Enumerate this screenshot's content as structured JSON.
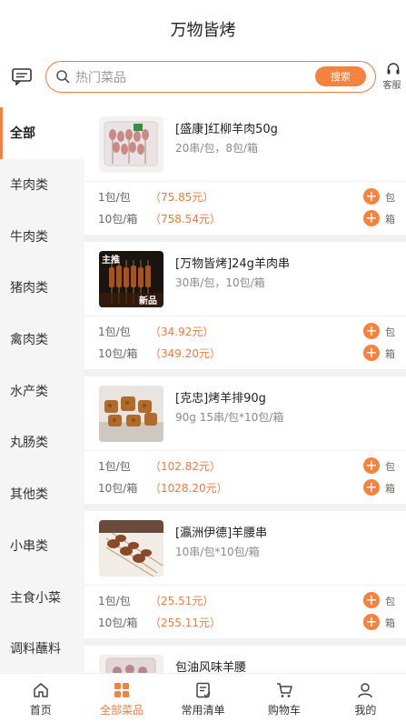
{
  "header": {
    "title": "万物皆烤"
  },
  "search": {
    "placeholder": "热门菜品",
    "button_label": "搜索",
    "service_label": "客服"
  },
  "sidebar": {
    "items": [
      {
        "label": "全部",
        "active": true
      },
      {
        "label": "羊肉类"
      },
      {
        "label": "牛肉类"
      },
      {
        "label": "猪肉类"
      },
      {
        "label": "禽肉类"
      },
      {
        "label": "水产类"
      },
      {
        "label": "丸肠类"
      },
      {
        "label": "其他类"
      },
      {
        "label": "小串类"
      },
      {
        "label": "主食小菜"
      },
      {
        "label": "调料蘸料"
      }
    ]
  },
  "products": [
    {
      "name": "[盛康]红柳羊肉50g",
      "spec": "20串/包，8包/箱",
      "prices": [
        {
          "unit": "1包/包",
          "price": "（75.85元）",
          "add_label": "包"
        },
        {
          "unit": "10包/箱",
          "price": "（758.54元）",
          "add_label": "箱"
        }
      ]
    },
    {
      "name": "[万物皆烤]24g羊肉串",
      "spec": "30串/包，10包/箱",
      "badge_main": "主推",
      "badge_new": "新品",
      "prices": [
        {
          "unit": "1包/包",
          "price": "（34.92元）",
          "add_label": "包"
        },
        {
          "unit": "10包/箱",
          "price": "（349.20元）",
          "add_label": "箱"
        }
      ]
    },
    {
      "name": "[克忠]烤羊排90g",
      "spec": "90g 15串/包*10包/箱",
      "prices": [
        {
          "unit": "1包/包",
          "price": "（102.82元）",
          "add_label": "包"
        },
        {
          "unit": "10包/箱",
          "price": "（1028.20元）",
          "add_label": "箱"
        }
      ]
    },
    {
      "name": "[瀛洲伊德]羊腰串",
      "spec": "10串/包*10包/箱",
      "prices": [
        {
          "unit": "1包/包",
          "price": "（25.51元）",
          "add_label": "包"
        },
        {
          "unit": "10包/箱",
          "price": "（255.11元）",
          "add_label": "箱"
        }
      ]
    },
    {
      "name": "包油风味羊腰",
      "spec": "",
      "prices": []
    }
  ],
  "add_symbol": "+",
  "tabbar": {
    "items": [
      {
        "label": "首页",
        "icon": "home-icon"
      },
      {
        "label": "全部菜品",
        "icon": "grid-icon",
        "active": true
      },
      {
        "label": "常用清单",
        "icon": "list-icon"
      },
      {
        "label": "购物车",
        "icon": "cart-icon"
      },
      {
        "label": "我的",
        "icon": "user-icon"
      }
    ]
  },
  "colors": {
    "accent": "#f5823f",
    "price": "#f07a3c",
    "sidebar_bg": "#f5f5f5"
  }
}
